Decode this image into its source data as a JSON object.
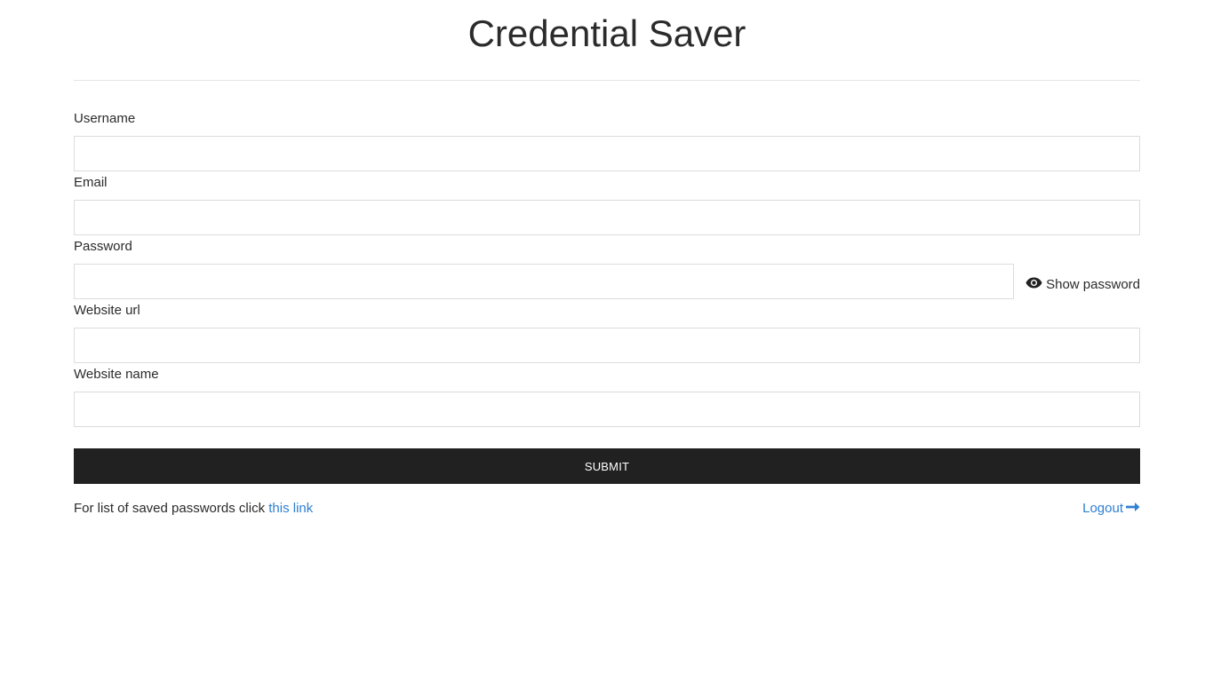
{
  "header": {
    "title": "Credential Saver"
  },
  "form": {
    "username_label": "Username",
    "username_value": "",
    "email_label": "Email",
    "email_value": "",
    "password_label": "Password",
    "password_value": "",
    "show_password_label": "Show password",
    "show_password_icon": "eye-icon",
    "website_url_label": "Website url",
    "website_url_value": "",
    "website_name_label": "Website name",
    "website_name_value": "",
    "submit_label": "SUBMIT"
  },
  "footer": {
    "prefix": "For list of saved passwords click ",
    "link_text": "this link",
    "logout_label": "Logout",
    "logout_icon": "arrow-right-icon",
    "link_color": "#2f80d3"
  },
  "colors": {
    "button_bg": "#212121",
    "button_text": "#ffffff"
  }
}
